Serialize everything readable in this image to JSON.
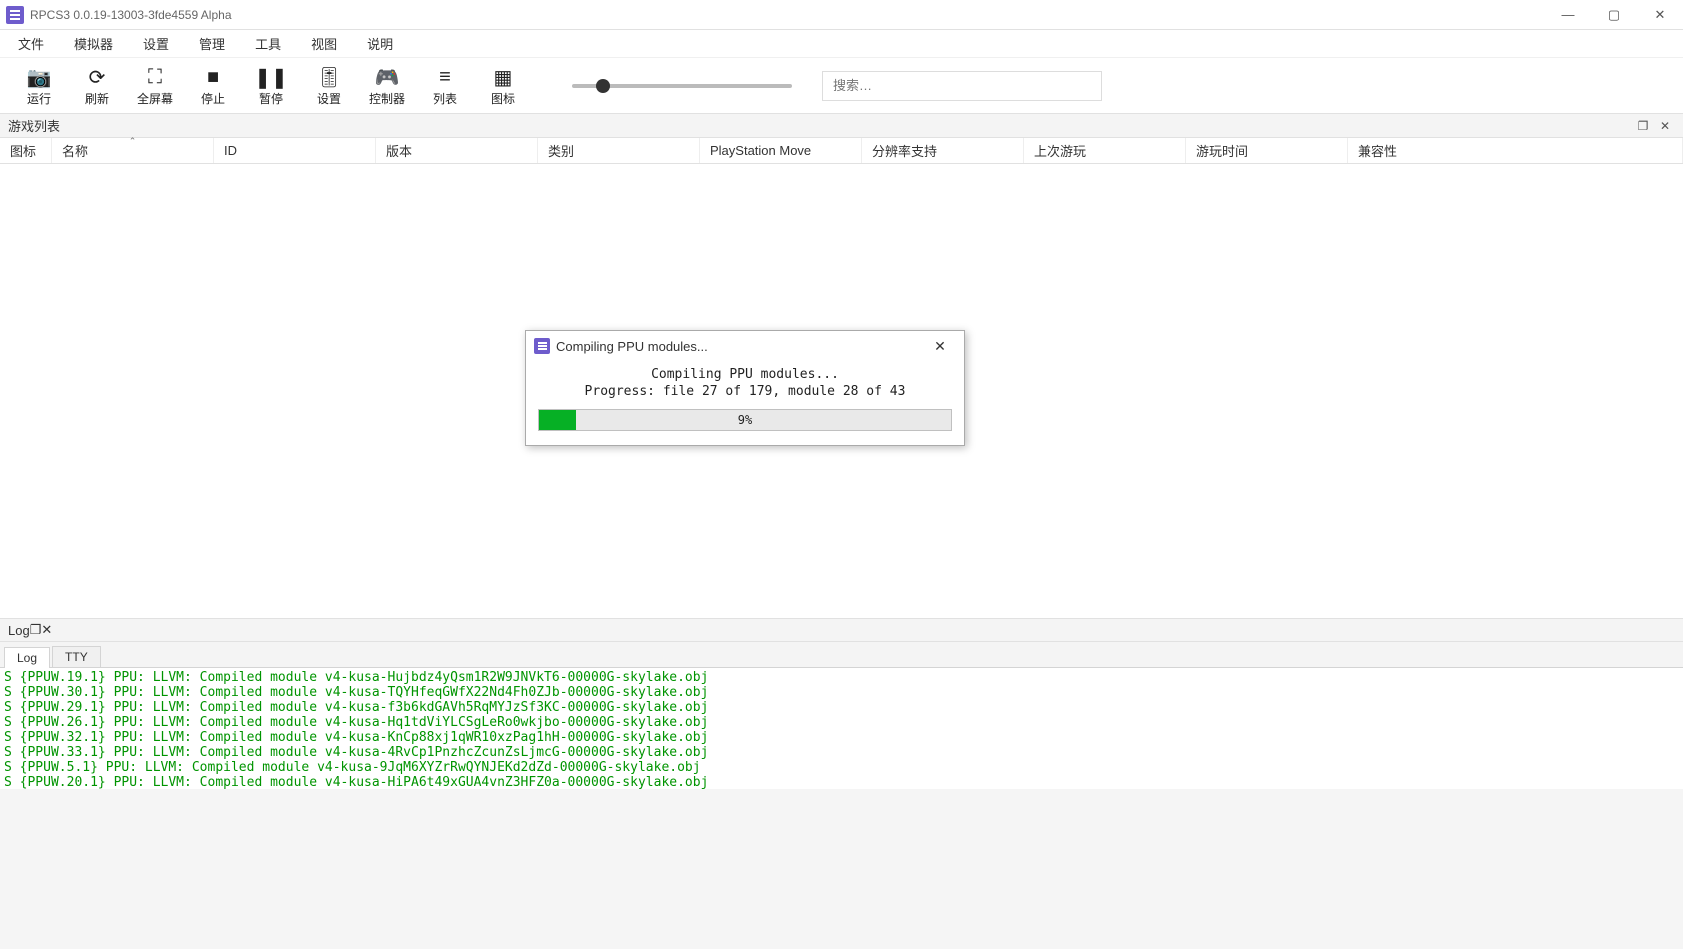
{
  "window": {
    "title": "RPCS3 0.0.19-13003-3fde4559 Alpha"
  },
  "menubar": {
    "items": [
      "文件",
      "模拟器",
      "设置",
      "管理",
      "工具",
      "视图",
      "说明"
    ]
  },
  "toolbar": {
    "items": [
      {
        "id": "run",
        "label": "运行",
        "glyph": "📷"
      },
      {
        "id": "refresh",
        "label": "刷新",
        "glyph": "⟳"
      },
      {
        "id": "fullscreen",
        "label": "全屏幕",
        "glyph": "⛶"
      },
      {
        "id": "stop",
        "label": "停止",
        "glyph": "■"
      },
      {
        "id": "pause",
        "label": "暂停",
        "glyph": "❚❚"
      },
      {
        "id": "settings",
        "label": "设置",
        "glyph": "🎚"
      },
      {
        "id": "controller",
        "label": "控制器",
        "glyph": "🎮"
      },
      {
        "id": "list",
        "label": "列表",
        "glyph": "≡"
      },
      {
        "id": "grid",
        "label": "图标",
        "glyph": "▦"
      }
    ],
    "search_placeholder": "搜索…"
  },
  "gamelist": {
    "panel_title": "游戏列表",
    "columns": {
      "icon": "图标",
      "name": "名称",
      "id": "ID",
      "version": "版本",
      "category": "类别",
      "psmove": "PlayStation Move",
      "resolution": "分辨率支持",
      "lastplay": "上次游玩",
      "playtime": "游玩时间",
      "compat": "兼容性"
    }
  },
  "log": {
    "panel_title": "Log",
    "tabs": {
      "log": "Log",
      "tty": "TTY"
    },
    "lines": [
      "S {PPUW.19.1} PPU: LLVM: Compiled module v4-kusa-Hujbdz4yQsm1R2W9JNVkT6-00000G-skylake.obj",
      "S {PPUW.30.1} PPU: LLVM: Compiled module v4-kusa-TQYHfeqGWfX22Nd4Fh0ZJb-00000G-skylake.obj",
      "S {PPUW.29.1} PPU: LLVM: Compiled module v4-kusa-f3b6kdGAVh5RqMYJzSf3KC-00000G-skylake.obj",
      "S {PPUW.26.1} PPU: LLVM: Compiled module v4-kusa-Hq1tdViYLCSgLeRo0wkjbo-00000G-skylake.obj",
      "S {PPUW.32.1} PPU: LLVM: Compiled module v4-kusa-KnCp88xj1qWR10xzPag1hH-00000G-skylake.obj",
      "S {PPUW.33.1} PPU: LLVM: Compiled module v4-kusa-4RvCp1PnzhcZcunZsLjmcG-00000G-skylake.obj",
      "S {PPUW.5.1} PPU: LLVM: Compiled module v4-kusa-9JqM6XYZrRwQYNJEKd2dZd-00000G-skylake.obj",
      "S {PPUW.20.1} PPU: LLVM: Compiled module v4-kusa-HiPA6t49xGUA4vnZ3HFZ0a-00000G-skylake.obj"
    ]
  },
  "modal": {
    "title": "Compiling PPU modules...",
    "line1": "Compiling PPU modules...",
    "line2": "Progress: file 27 of 179, module 28 of 43",
    "percent_label": "9%",
    "percent_value": 9
  }
}
